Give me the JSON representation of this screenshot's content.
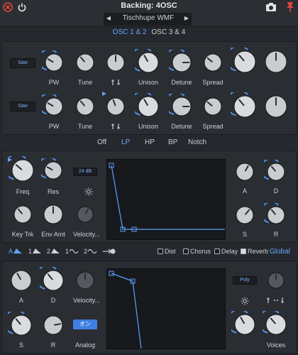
{
  "topbar": {
    "title": "Backing: 4OSC",
    "preset": "Tischhupe WMF"
  },
  "osc_tabs": [
    {
      "label": "OSC 1 & 2",
      "active": true
    },
    {
      "label": "OSC 3 & 4",
      "active": false
    }
  ],
  "osc_rows": [
    {
      "wave": "Saw",
      "labels": [
        "PW",
        "Tune",
        "Unison",
        "Detune",
        "Spread"
      ]
    },
    {
      "wave": "Saw",
      "labels": [
        "PW",
        "Tune",
        "Unison",
        "Detune",
        "Spread"
      ]
    }
  ],
  "filter_types": [
    {
      "label": "Off",
      "active": false
    },
    {
      "label": "LP",
      "active": true
    },
    {
      "label": "HP",
      "active": false
    },
    {
      "label": "BP",
      "active": false
    },
    {
      "label": "Notch",
      "active": false
    }
  ],
  "filter": {
    "slope": "24 dB",
    "knob_labels": {
      "freq": "Freq",
      "res": "Res",
      "keytrk": "Key Trk",
      "envamt": "Env Amt",
      "velocity": "Velocity..."
    },
    "env_labels": {
      "a": "A",
      "d": "D",
      "s": "S",
      "r": "R"
    }
  },
  "mod_tabs": [
    {
      "label": "A",
      "active": true
    },
    {
      "label": "1",
      "active": false
    },
    {
      "label": "2",
      "active": false
    },
    {
      "label": "1",
      "active": false
    },
    {
      "label": "2",
      "active": false
    }
  ],
  "effects": [
    {
      "label": "Dist",
      "checked": false
    },
    {
      "label": "Chorus",
      "checked": false
    },
    {
      "label": "Delay",
      "checked": false
    },
    {
      "label": "Reverb",
      "checked": true
    }
  ],
  "global_label": "Global",
  "amp": {
    "labels": {
      "a": "A",
      "d": "D",
      "velocity": "Velocity...",
      "s": "S",
      "r": "R",
      "analog": "Analog"
    },
    "analog_state": "オン",
    "poly": "Poly",
    "voices": "Voices"
  }
}
